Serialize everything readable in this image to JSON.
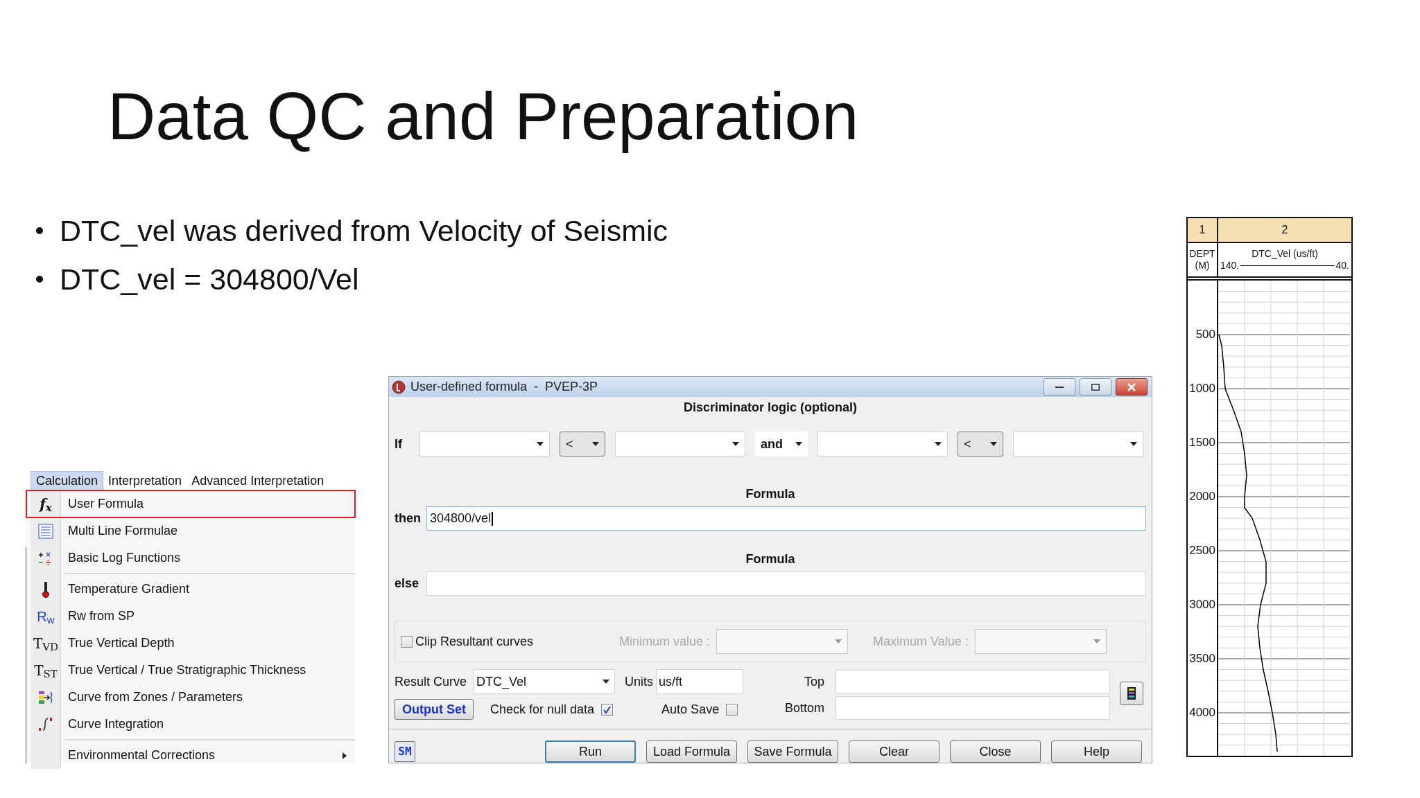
{
  "slide": {
    "title": "Data QC and Preparation",
    "bullets": [
      "DTC_vel was derived from Velocity of Seismic",
      "DTC_vel = 304800/Vel"
    ]
  },
  "menu": {
    "menubar": [
      {
        "label": "Calculation",
        "selected": true
      },
      {
        "label": "Interpretation",
        "selected": false
      },
      {
        "label": "Advanced Interpretation",
        "selected": false
      }
    ],
    "groups": [
      [
        {
          "label": "User Formula",
          "icon_text": "f$_{x}$",
          "highlighted": true,
          "submenu": false
        },
        {
          "label": "Multi Line Formulae",
          "highlighted": false,
          "submenu": false
        },
        {
          "label": "Basic Log Functions",
          "highlighted": false,
          "submenu": false
        }
      ],
      [
        {
          "label": "Temperature Gradient",
          "highlighted": false,
          "submenu": false
        },
        {
          "label": "Rw from SP",
          "icon_text": "R$_{w}$",
          "highlighted": false,
          "submenu": false
        },
        {
          "label": "True Vertical Depth",
          "icon_text": "T$_{VD}$",
          "highlighted": false,
          "submenu": false
        },
        {
          "label": "True Vertical / True Stratigraphic Thickness",
          "icon_text": "T$_{ST}$",
          "highlighted": false,
          "submenu": false
        },
        {
          "label": "Curve from Zones / Parameters",
          "highlighted": false,
          "submenu": false
        },
        {
          "label": "Curve Integration",
          "highlighted": false,
          "submenu": false
        }
      ],
      [
        {
          "label": "Environmental Corrections",
          "highlighted": false,
          "submenu": true
        }
      ]
    ]
  },
  "dialog": {
    "title": "User-defined formula  -  PVEP-3P",
    "section_title": "Discriminator logic (optional)",
    "if_label": "If",
    "conditions": [
      {
        "kind": "field"
      },
      {
        "kind": "operator",
        "value": "<"
      },
      {
        "kind": "field"
      },
      {
        "kind": "plain",
        "value": "and"
      },
      {
        "kind": "field"
      },
      {
        "kind": "operator",
        "value": "<"
      },
      {
        "kind": "field"
      }
    ],
    "then": {
      "heading": "Formula",
      "label": "then",
      "value": "304800/vel",
      "focused": true
    },
    "else": {
      "heading": "Formula",
      "label": "else",
      "focused": false
    },
    "clip": {
      "label": "Clip Resultant curves",
      "checked": false
    },
    "minimum": {
      "label": "Minimum value :",
      "disabled": true
    },
    "maximum": {
      "label": "Maximum Value :",
      "disabled": true
    },
    "result_curve": {
      "label": "Result Curve",
      "value": "DTC_Vel"
    },
    "units": {
      "label": "Units",
      "value": "us/ft"
    },
    "top": {
      "label": "Top"
    },
    "bottom": {
      "label": "Bottom"
    },
    "output_set": "Output Set",
    "null_check": {
      "label": "Check for null data",
      "checked": true
    },
    "auto_save": {
      "label": "Auto Save",
      "checked": false
    },
    "sm_button": "SM",
    "buttons": [
      {
        "label": "Run",
        "default": true
      },
      {
        "label": "Load Formula",
        "default": false
      },
      {
        "label": "Save Formula",
        "default": false
      },
      {
        "label": "Clear",
        "default": false
      },
      {
        "label": "Close",
        "default": false
      },
      {
        "label": "Help",
        "default": false
      }
    ]
  },
  "log_track": {
    "track_numbers": [
      "1",
      "2"
    ],
    "depth_header": [
      "DEPT",
      "(M)"
    ],
    "curve_header": "DTC_Vel (us/ft)",
    "scale_labels": [
      "140.",
      "40."
    ],
    "depth_labels": [
      "500",
      "1000",
      "1500",
      "2000",
      "2500",
      "3000",
      "3500",
      "4000"
    ]
  }
}
